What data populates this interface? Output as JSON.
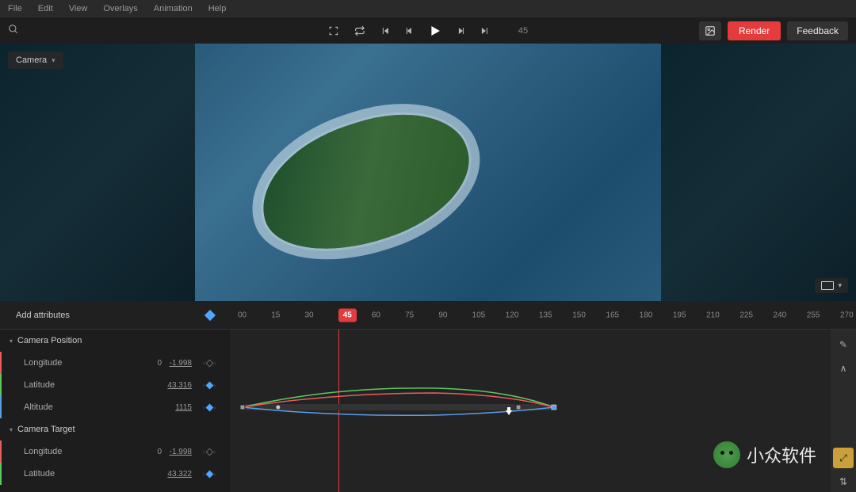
{
  "menu": {
    "file": "File",
    "edit": "Edit",
    "view": "View",
    "overlays": "Overlays",
    "animation": "Animation",
    "help": "Help"
  },
  "toolbar": {
    "render": "Render",
    "feedback": "Feedback",
    "current_frame": "45"
  },
  "viewport": {
    "camera_dropdown": "Camera"
  },
  "timeline": {
    "add_attributes": "Add attributes",
    "ticks": [
      "00",
      "15",
      "30",
      "45",
      "60",
      "75",
      "90",
      "105",
      "120",
      "135",
      "150",
      "165",
      "180",
      "195",
      "210",
      "225",
      "240",
      "255",
      "270"
    ],
    "current_tick": "45",
    "playhead_frame": 45,
    "frame_range": [
      0,
      270
    ]
  },
  "properties": {
    "groups": [
      {
        "name": "Camera Position",
        "attrs": [
          {
            "label": "Longitude",
            "value_a": "0",
            "value_b": "-1.998",
            "keyed": false,
            "cls": "lon"
          },
          {
            "label": "Latitude",
            "value_a": "",
            "value_b": "43.316",
            "keyed": true,
            "cls": "lat"
          },
          {
            "label": "Altitude",
            "value_a": "",
            "value_b": "1115",
            "keyed": true,
            "cls": "alt"
          }
        ]
      },
      {
        "name": "Camera Target",
        "attrs": [
          {
            "label": "Longitude",
            "value_a": "0",
            "value_b": "-1.998",
            "keyed": false,
            "cls": "lon"
          },
          {
            "label": "Latitude",
            "value_a": "",
            "value_b": "43.322",
            "keyed": true,
            "cls": "lat"
          }
        ]
      }
    ]
  },
  "watermark_text": "小众软件"
}
